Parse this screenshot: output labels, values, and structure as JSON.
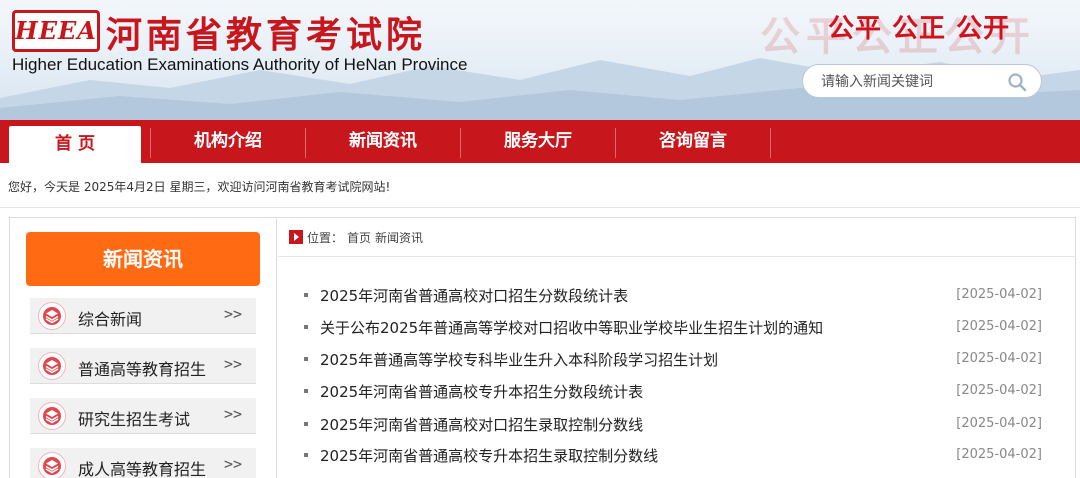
{
  "header": {
    "logo_text": "HEEA",
    "title": "河南省教育考试院",
    "subtitle": "Higher Education Examinations Authority of HeNan Province",
    "slogan": "公平 公正 公开",
    "slogan_ghost": "公平公正公开",
    "search": {
      "placeholder": "请输入新闻关键词",
      "value": "",
      "icon": "search-icon"
    }
  },
  "nav": {
    "items": [
      {
        "label": "首 页",
        "active": true
      },
      {
        "label": "机构介绍",
        "active": false
      },
      {
        "label": "新闻资讯",
        "active": false
      },
      {
        "label": "服务大厅",
        "active": false
      },
      {
        "label": "咨询留言",
        "active": false
      }
    ]
  },
  "greeting": "您好，今天是 2025年4月2日 星期三，欢迎访问河南省教育考试院网站!",
  "sidebar": {
    "title": "新闻资讯",
    "items": [
      {
        "label": "综合新闻",
        "icon": "layers-icon",
        "chevron": ">>"
      },
      {
        "label": "普通高等教育招生",
        "icon": "layers-icon",
        "chevron": ">>"
      },
      {
        "label": "研究生招生考试",
        "icon": "layers-icon",
        "chevron": ">>"
      },
      {
        "label": "成人高等教育招生",
        "icon": "layers-icon",
        "chevron": ">>"
      }
    ]
  },
  "breadcrumb": {
    "prefix": "位置：",
    "home": "首页",
    "current": "新闻资讯"
  },
  "news": [
    {
      "title": "2025年河南省普通高校对口招生分数段统计表",
      "date": "[2025-04-02]"
    },
    {
      "title": "关于公布2025年普通高等学校对口招收中等职业学校毕业生招生计划的通知",
      "date": "[2025-04-02]"
    },
    {
      "title": "2025年普通高等学校专科毕业生升入本科阶段学习招生计划",
      "date": "[2025-04-02]"
    },
    {
      "title": "2025年河南省普通高校专升本招生分数段统计表",
      "date": "[2025-04-02]"
    },
    {
      "title": "2025年河南省普通高校对口招生录取控制分数线",
      "date": "[2025-04-02]"
    },
    {
      "title": "2025年河南省普通高校专升本招生录取控制分数线",
      "date": "[2025-04-02]"
    }
  ],
  "colors": {
    "brand_red": "#c8161d",
    "accent_orange": "#ff6a13"
  }
}
